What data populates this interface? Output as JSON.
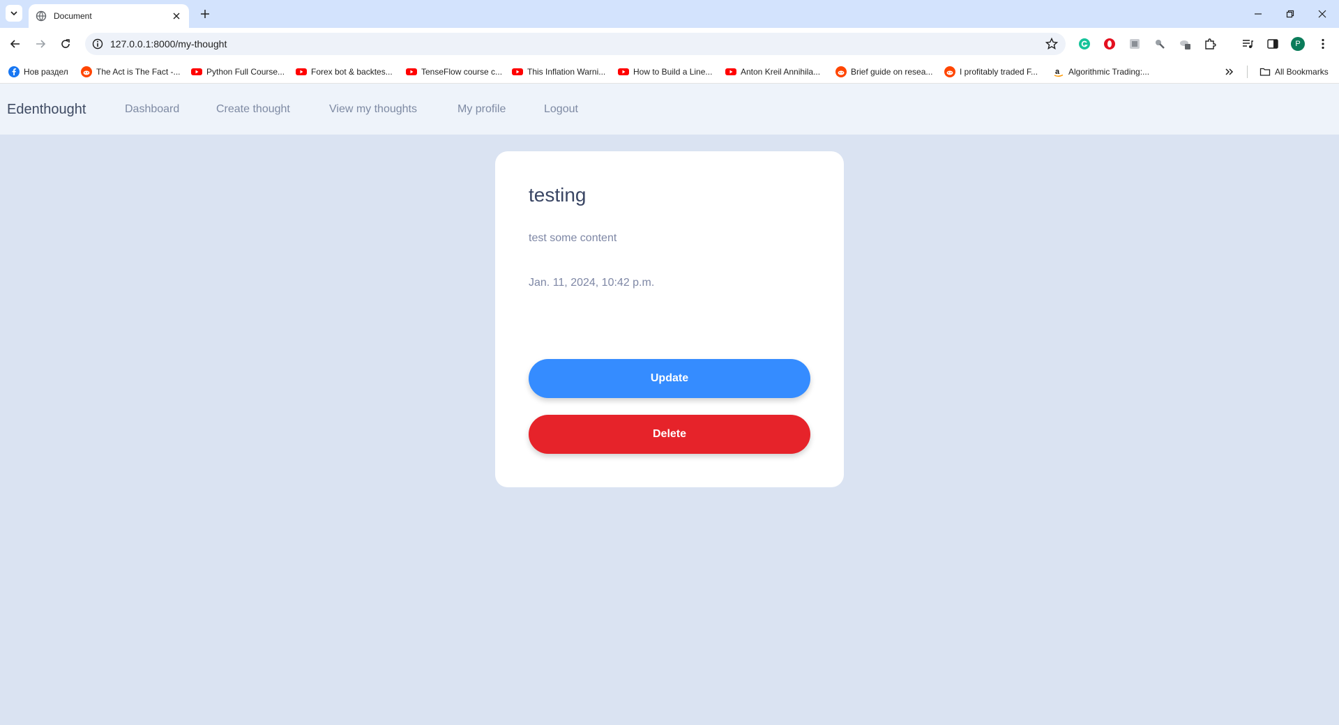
{
  "browser": {
    "tab_title": "Document",
    "url": "127.0.0.1:8000/my-thought",
    "bookmarks": [
      {
        "label": "Нов раздел",
        "icon": "facebook-icon"
      },
      {
        "label": "The Act is The Fact -...",
        "icon": "reddit-icon"
      },
      {
        "label": "Python Full Course...",
        "icon": "youtube-icon"
      },
      {
        "label": "Forex bot & backtes...",
        "icon": "youtube-icon"
      },
      {
        "label": "TenseFlow course c...",
        "icon": "youtube-icon"
      },
      {
        "label": "This Inflation Warni...",
        "icon": "youtube-icon"
      },
      {
        "label": "How to Build a Line...",
        "icon": "youtube-icon"
      },
      {
        "label": "Anton Kreil Annihila...",
        "icon": "youtube-icon"
      },
      {
        "label": "Brief guide on resea...",
        "icon": "reddit-icon"
      },
      {
        "label": "I profitably traded F...",
        "icon": "reddit-icon"
      },
      {
        "label": "Algorithmic Trading:...",
        "icon": "amazon-icon"
      }
    ],
    "all_bookmarks_label": "All Bookmarks",
    "profile_initial": "P"
  },
  "navbar": {
    "brand": "Edenthought",
    "links": [
      "Dashboard",
      "Create thought",
      "View my thoughts",
      "My profile",
      "Logout"
    ]
  },
  "thought": {
    "title": "testing",
    "content": "test some content",
    "date": "Jan. 11, 2024, 10:42 p.m.",
    "update_label": "Update",
    "delete_label": "Delete"
  },
  "colors": {
    "page_bg": "#dae3f2",
    "update": "#358cff",
    "delete": "#e6232a"
  }
}
